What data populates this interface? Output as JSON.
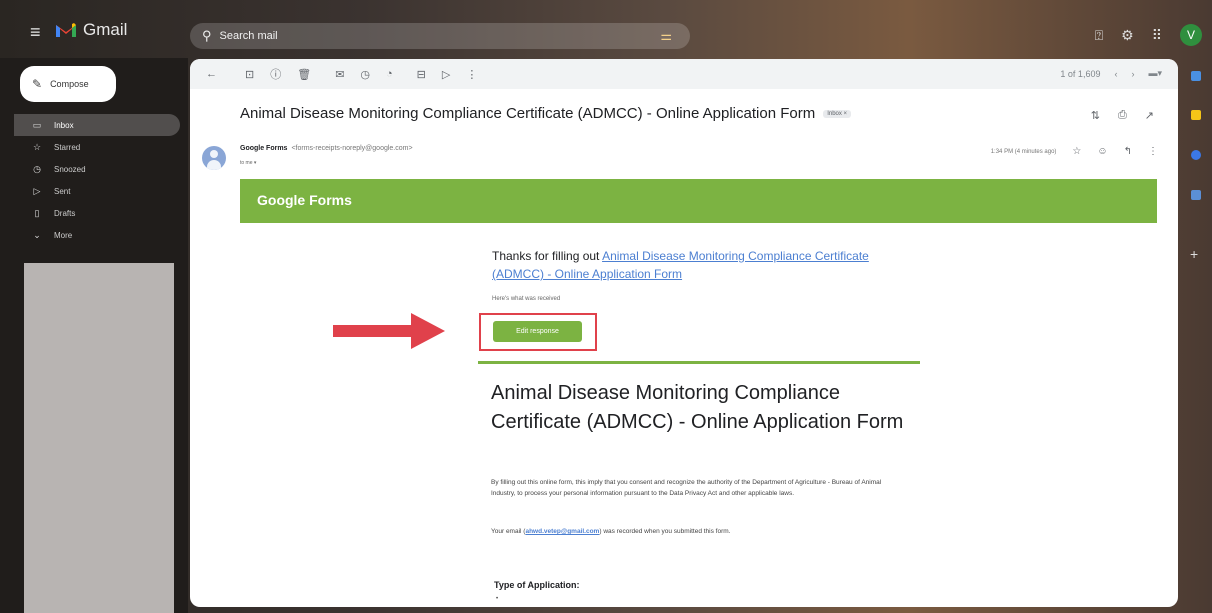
{
  "app": {
    "name": "Gmail",
    "search_placeholder": "Search mail",
    "avatar_letter": "V",
    "colors": {
      "accent_green": "#7cb342",
      "highlight_red": "#e0414b",
      "link_blue": "#4c7fd1"
    }
  },
  "sidebar": {
    "compose_label": "Compose",
    "items": [
      {
        "label": "Inbox",
        "icon": "inbox-icon"
      },
      {
        "label": "Starred",
        "icon": "star-icon"
      },
      {
        "label": "Snoozed",
        "icon": "clock-icon"
      },
      {
        "label": "Sent",
        "icon": "send-icon"
      },
      {
        "label": "Drafts",
        "icon": "draft-icon"
      },
      {
        "label": "More",
        "icon": "chevron-down-icon"
      }
    ]
  },
  "toolbar": {
    "pagination": "1 of 1,609"
  },
  "email": {
    "subject": "Animal Disease Monitoring Compliance Certificate (ADMCC) - Online Application Form",
    "label_badge": "Inbox ×",
    "sender_name": "Google Forms",
    "sender_email": "<forms-receipts-noreply@google.com>",
    "recipient": "to me ▾",
    "time": "1:34 PM (4 minutes ago)"
  },
  "form_email": {
    "header_brand": "Google Forms",
    "thanks_prefix": "Thanks for filling out ",
    "form_link": "Animal Disease Monitoring Compliance Certificate (ADMCC) - Online Application Form",
    "received_text": "Here's what was received",
    "edit_button": "Edit response",
    "form_title": "Animal Disease Monitoring Compliance Certificate (ADMCC) - Online Application Form",
    "description": "By filling out this online form, this imply that you consent and recognize the authority of the Department of Agriculture - Bureau of Animal Industry, to process your personal information pursuant to the Data Privacy Act and other applicable laws.",
    "email_prefix": "Your email (",
    "email_address": "ahwd.vetep@gmail.com",
    "email_suffix": ") was recorded when you submitted this form.",
    "question_label": "Type of Application:",
    "question_value": "•"
  }
}
